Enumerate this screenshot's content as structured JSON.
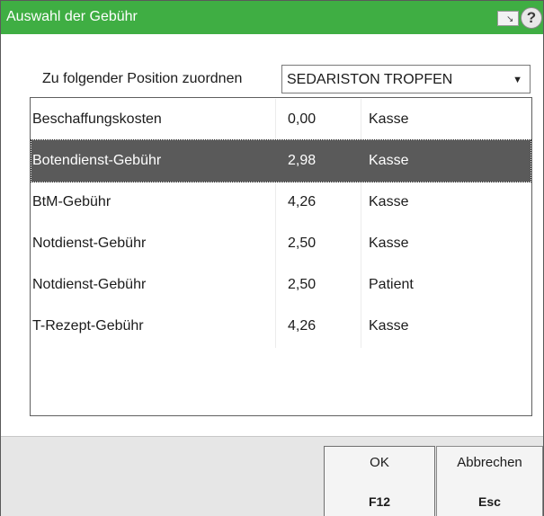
{
  "window": {
    "title": "Auswahl der Gebühr",
    "title_bar_color": "#3fae43",
    "icons": [
      "monitor-arrow-icon",
      "help-icon"
    ],
    "help_glyph": "?"
  },
  "assignment": {
    "label": "Zu folgender Position zuordnen",
    "selected_value": "SEDARISTON TROPFEN"
  },
  "fees": {
    "rows": [
      {
        "name": "Beschaffungskosten",
        "amount": "0,00",
        "payer": "Kasse",
        "selected": false
      },
      {
        "name": "Botendienst-Gebühr",
        "amount": "2,98",
        "payer": "Kasse",
        "selected": true
      },
      {
        "name": "BtM-Gebühr",
        "amount": "4,26",
        "payer": "Kasse",
        "selected": false
      },
      {
        "name": "Notdienst-Gebühr",
        "amount": "2,50",
        "payer": "Kasse",
        "selected": false
      },
      {
        "name": "Notdienst-Gebühr",
        "amount": "2,50",
        "payer": "Patient",
        "selected": false
      },
      {
        "name": "T-Rezept-Gebühr",
        "amount": "4,26",
        "payer": "Kasse",
        "selected": false
      }
    ],
    "selected_color": "#5a5a5a"
  },
  "buttons": {
    "ok": {
      "label": "OK",
      "key": "F12"
    },
    "cancel": {
      "label": "Abbrechen",
      "key": "Esc"
    }
  }
}
